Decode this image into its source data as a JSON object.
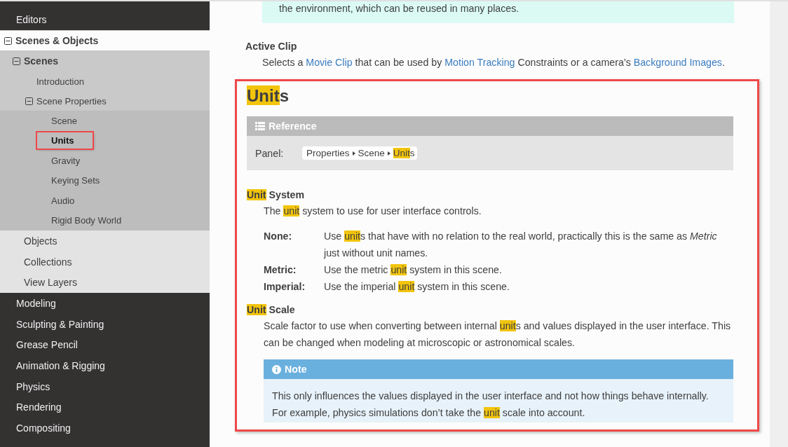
{
  "sidebar": {
    "items": [
      {
        "label": "Editors",
        "selected": false
      },
      {
        "label": "Scenes & Objects",
        "selected": false,
        "expanded": true,
        "children": [
          {
            "label": "Scenes",
            "selected": false,
            "expanded": true,
            "children": [
              {
                "label": "Introduction",
                "selected": false
              },
              {
                "label": "Scene Properties",
                "selected": false,
                "expanded": true,
                "children": [
                  {
                    "label": "Scene",
                    "selected": false
                  },
                  {
                    "label": "Units",
                    "selected": true,
                    "annotated": true
                  },
                  {
                    "label": "Gravity",
                    "selected": false
                  },
                  {
                    "label": "Keying Sets",
                    "selected": false
                  },
                  {
                    "label": "Audio",
                    "selected": false
                  },
                  {
                    "label": "Rigid Body World",
                    "selected": false
                  }
                ]
              }
            ]
          },
          {
            "label": "Objects",
            "selected": false
          },
          {
            "label": "Collections",
            "selected": false
          },
          {
            "label": "View Layers",
            "selected": false
          }
        ]
      },
      {
        "label": "Modeling",
        "selected": false
      },
      {
        "label": "Sculpting & Painting",
        "selected": false
      },
      {
        "label": "Grease Pencil",
        "selected": false
      },
      {
        "label": "Animation & Rigging",
        "selected": false
      },
      {
        "label": "Physics",
        "selected": false
      },
      {
        "label": "Rendering",
        "selected": false
      },
      {
        "label": "Compositing",
        "selected": false
      }
    ]
  },
  "content": {
    "tip_box": {
      "text": "the environment, which can be reused in many places."
    },
    "definition": {
      "term": "Active Clip",
      "description": [
        {
          "kind": "plain",
          "text": "Selects a "
        },
        {
          "kind": "link",
          "text": "Movie Clip"
        },
        {
          "kind": "plain",
          "text": " that can be used by "
        },
        {
          "kind": "link",
          "text": "Motion Tracking"
        },
        {
          "kind": "plain",
          "text": " Constraints or a camera’s "
        },
        {
          "kind": "link",
          "text": "Background Images"
        },
        {
          "kind": "plain",
          "text": "."
        }
      ]
    },
    "section": {
      "annotated": true,
      "heading": [
        {
          "kind": "highlight",
          "text": "Unit"
        },
        {
          "kind": "plain",
          "text": "s"
        }
      ],
      "reference": {
        "title": "Reference",
        "label": "Panel:",
        "path": [
          [
            {
              "kind": "plain",
              "text": "Properties"
            }
          ],
          [
            {
              "kind": "plain",
              "text": "Scene"
            }
          ],
          [
            {
              "kind": "highlight",
              "text": "Unit"
            },
            {
              "kind": "plain",
              "text": "s"
            }
          ]
        ]
      },
      "properties": [
        {
          "term": [
            {
              "kind": "highlight",
              "text": "Unit"
            },
            {
              "kind": "plain",
              "text": " System"
            }
          ],
          "description": [
            {
              "kind": "plain",
              "text": "The "
            },
            {
              "kind": "highlight",
              "text": "unit"
            },
            {
              "kind": "plain",
              "text": " system to use for user interface controls."
            }
          ],
          "options": [
            {
              "term": "None:",
              "description": [
                {
                  "kind": "plain",
                  "text": "Use "
                },
                {
                  "kind": "highlight",
                  "text": "unit"
                },
                {
                  "kind": "plain",
                  "text": "s that have with no relation to the real world, practically this is the same as "
                },
                {
                  "kind": "italic",
                  "text": "Metric"
                },
                {
                  "kind": "plain",
                  "text": " just without unit names."
                }
              ]
            },
            {
              "term": "Metric:",
              "description": [
                {
                  "kind": "plain",
                  "text": "Use the metric "
                },
                {
                  "kind": "highlight",
                  "text": "unit"
                },
                {
                  "kind": "plain",
                  "text": " system in this scene."
                }
              ]
            },
            {
              "term": "Imperial:",
              "description": [
                {
                  "kind": "plain",
                  "text": "Use the imperial "
                },
                {
                  "kind": "highlight",
                  "text": "unit"
                },
                {
                  "kind": "plain",
                  "text": " system in this scene."
                }
              ]
            }
          ]
        },
        {
          "term": [
            {
              "kind": "highlight",
              "text": "Unit"
            },
            {
              "kind": "plain",
              "text": " Scale"
            }
          ],
          "description": [
            {
              "kind": "plain",
              "text": "Scale factor to use when converting between internal "
            },
            {
              "kind": "highlight",
              "text": "unit"
            },
            {
              "kind": "plain",
              "text": "s and values displayed in the user interface. This can be changed when modeling at microscopic or astronomical scales."
            }
          ],
          "note": {
            "title": "Note",
            "text": [
              {
                "kind": "plain",
                "text": "This only influences the values displayed in the user interface and not how things behave internally. For example, physics simulations don’t take the "
              },
              {
                "kind": "highlight",
                "text": "unit"
              },
              {
                "kind": "plain",
                "text": " scale into account."
              }
            ]
          }
        }
      ]
    }
  }
}
